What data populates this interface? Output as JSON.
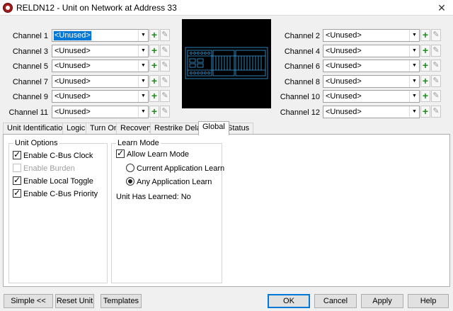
{
  "window": {
    "title": "RELDN12 - Unit on Network at Address 33"
  },
  "channels_left": [
    {
      "label": "Channel 1",
      "value": "<Unused>",
      "selected": true
    },
    {
      "label": "Channel 3",
      "value": "<Unused>"
    },
    {
      "label": "Channel 5",
      "value": "<Unused>"
    },
    {
      "label": "Channel 7",
      "value": "<Unused>"
    },
    {
      "label": "Channel 9",
      "value": "<Unused>"
    },
    {
      "label": "Channel 11",
      "value": "<Unused>"
    }
  ],
  "channels_right": [
    {
      "label": "Channel 2",
      "value": "<Unused>"
    },
    {
      "label": "Channel 4",
      "value": "<Unused>"
    },
    {
      "label": "Channel 6",
      "value": "<Unused>"
    },
    {
      "label": "Channel 8",
      "value": "<Unused>"
    },
    {
      "label": "Channel 10",
      "value": "<Unused>"
    },
    {
      "label": "Channel 12",
      "value": "<Unused>"
    }
  ],
  "tabs": [
    {
      "label": "Unit Identification"
    },
    {
      "label": "Logic"
    },
    {
      "label": "Turn On"
    },
    {
      "label": "Recovery"
    },
    {
      "label": "Restrike Delay"
    },
    {
      "label": "Global",
      "active": true
    },
    {
      "label": "Status"
    }
  ],
  "unit_options": {
    "title": "Unit Options",
    "items": [
      {
        "label": "Enable C-Bus Clock",
        "checked": true,
        "disabled": false
      },
      {
        "label": "Enable Burden",
        "checked": false,
        "disabled": true
      },
      {
        "label": "Enable Local Toggle",
        "checked": true,
        "disabled": false
      },
      {
        "label": "Enable C-Bus Priority",
        "checked": true,
        "disabled": false
      }
    ]
  },
  "learn_mode": {
    "title": "Learn Mode",
    "allow_label": "Allow Learn Mode",
    "allow_checked": true,
    "options": [
      {
        "label": "Current Application Learn",
        "selected": false
      },
      {
        "label": "Any Application Learn",
        "selected": true
      }
    ],
    "status": "Unit Has Learned: No"
  },
  "buttons": {
    "simple": "Simple <<",
    "reset": "Reset Unit",
    "templates": "Templates",
    "ok": "OK",
    "cancel": "Cancel",
    "apply": "Apply",
    "help": "Help"
  },
  "colors": {
    "accent": "#0078d7",
    "add_icon": "#1f8a1f",
    "unit_image_line": "#3aa0e0"
  }
}
